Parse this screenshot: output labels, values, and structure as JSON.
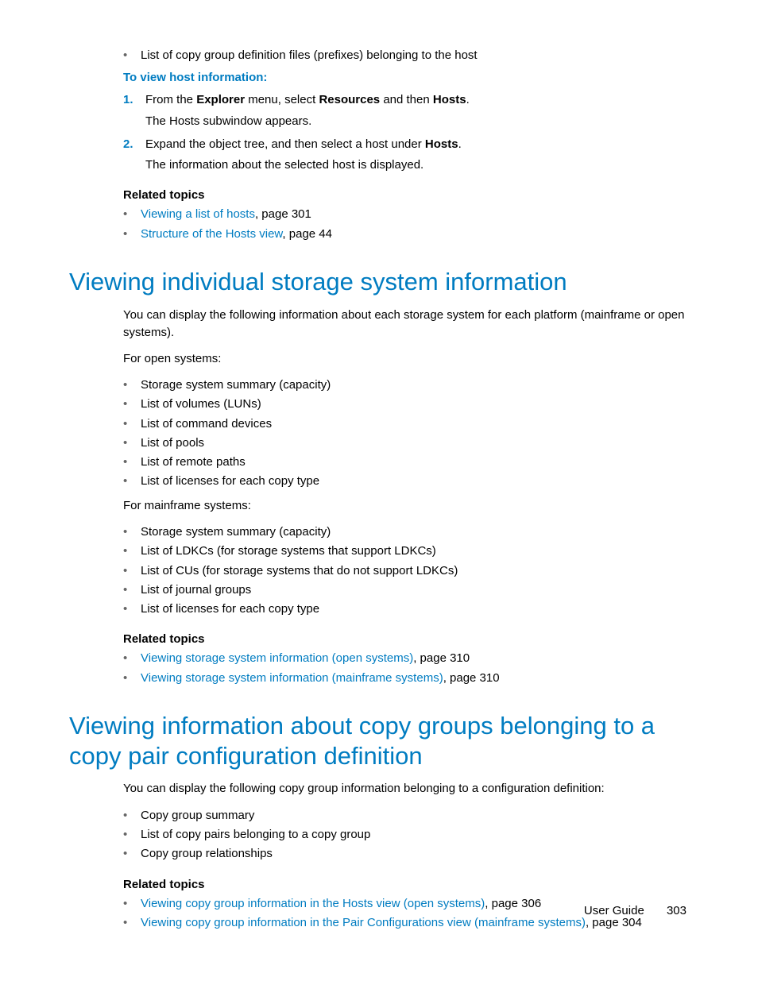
{
  "top_bullet": "List of copy group definition files (prefixes) belonging to the host",
  "procedure_heading": "To view host information:",
  "steps": [
    {
      "num": "1.",
      "pre": "From the ",
      "b1": "Explorer",
      "mid1": " menu, select ",
      "b2": "Resources",
      "mid2": " and then ",
      "b3": "Hosts",
      "post": ".",
      "sub": "The Hosts subwindow appears."
    },
    {
      "num": "2.",
      "pre": "Expand the object tree, and then select a host under ",
      "b1": "Hosts",
      "post": ".",
      "sub": "The information about the selected host is displayed."
    }
  ],
  "related_heading": "Related topics",
  "related1": [
    {
      "link": "Viewing a list of hosts",
      "suffix": ", page 301"
    },
    {
      "link": "Structure of the Hosts view",
      "suffix": ", page 44"
    }
  ],
  "section1_heading": "Viewing individual storage system information",
  "section1_intro": "You can display the following information about each storage system for each platform (mainframe or open systems).",
  "open_label": "For open systems:",
  "open_items": [
    "Storage system summary (capacity)",
    "List of volumes (LUNs)",
    "List of command devices",
    "List of pools",
    "List of remote paths",
    "List of licenses for each copy type"
  ],
  "mainframe_label": "For mainframe systems:",
  "mainframe_items": [
    "Storage system summary (capacity)",
    "List of LDKCs (for storage systems that support LDKCs)",
    "List of CUs (for storage systems that do not support LDKCs)",
    "List of journal groups",
    "List of licenses for each copy type"
  ],
  "related2": [
    {
      "link": "Viewing storage system information (open systems)",
      "suffix": ", page 310"
    },
    {
      "link": "Viewing storage system information (mainframe systems)",
      "suffix": ", page 310"
    }
  ],
  "section2_heading": "Viewing information about copy groups belonging to a copy pair configuration definition",
  "section2_intro": "You can display the following copy group information belonging to a configuration definition:",
  "section2_items": [
    "Copy group summary",
    "List of copy pairs belonging to a copy group",
    "Copy group relationships"
  ],
  "related3": [
    {
      "link": "Viewing copy group information in the Hosts view (open systems)",
      "suffix": ", page 306"
    },
    {
      "link": "Viewing copy group information in the Pair Configurations view (mainframe systems)",
      "suffix": ", page 304"
    }
  ],
  "footer_label": "User Guide",
  "footer_page": "303"
}
